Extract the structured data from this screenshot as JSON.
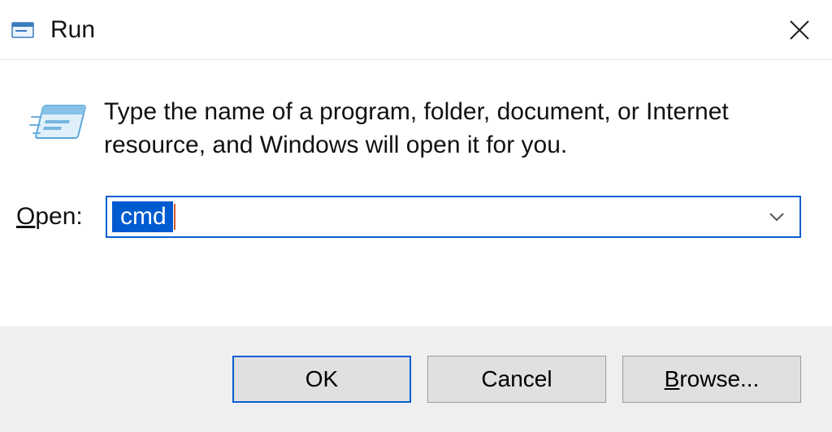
{
  "window": {
    "title": "Run"
  },
  "body": {
    "description": "Type the name of a program, folder, document, or Internet resource, and Windows will open it for you.",
    "open_label_pre": "O",
    "open_label_post": "pen:",
    "open_value": "cmd"
  },
  "buttons": {
    "ok": "OK",
    "cancel": "Cancel",
    "browse_pre": "B",
    "browse_post": "rowse..."
  }
}
